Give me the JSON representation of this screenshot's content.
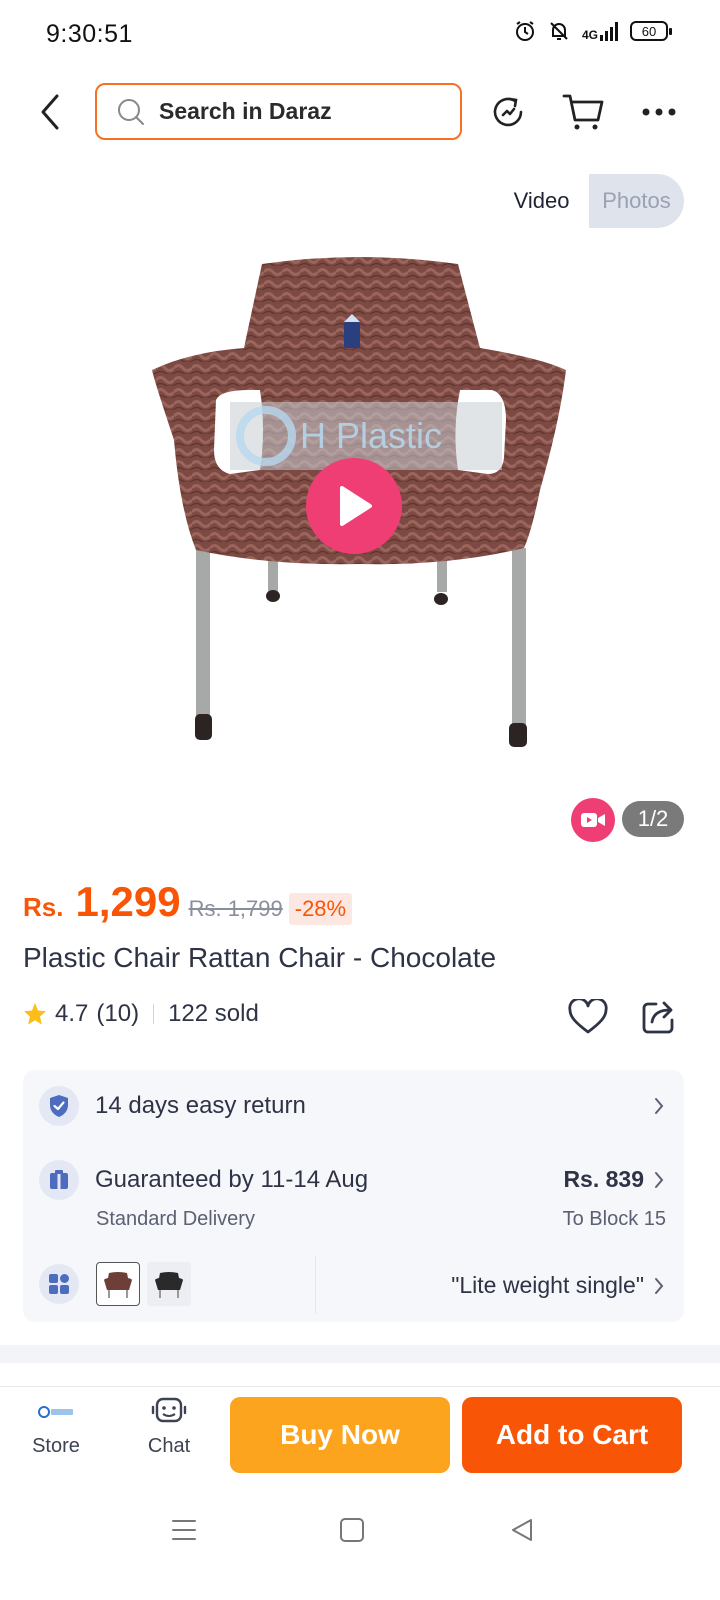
{
  "status_bar": {
    "time": "9:30:51",
    "network": "4G",
    "battery": "60",
    "icons": [
      "alarm-icon",
      "bell-off-icon",
      "signal-icon",
      "battery-icon"
    ]
  },
  "header": {
    "search_placeholder": "Search in Daraz",
    "icons": [
      "back-icon",
      "search-icon",
      "history-icon",
      "cart-icon",
      "more-icon"
    ]
  },
  "media": {
    "toggle": {
      "video_label": "Video",
      "photos_label": "Photos",
      "active": "Video"
    },
    "page_indicator": "1/2",
    "watermark_text": "H Plastic"
  },
  "product": {
    "currency": "Rs.",
    "price": "1,299",
    "original_price": "Rs. 1,799",
    "discount": "-28%",
    "title": "Plastic Chair Rattan Chair - Chocolate",
    "rating": "4.7",
    "rating_count": "(10)",
    "sold": "122 sold"
  },
  "info": {
    "returns": "14 days easy return",
    "delivery_title": "Guaranteed by 11-14 Aug",
    "delivery_type": "Standard Delivery",
    "delivery_price": "Rs. 839",
    "delivery_location": "To Block 15",
    "variant_label": "\"Lite weight single\""
  },
  "bottom_bar": {
    "store_label": "Store",
    "chat_label": "Chat",
    "buy_now": "Buy Now",
    "add_to_cart": "Add to Cart"
  },
  "colors": {
    "accent": "#f85606",
    "buy_now": "#fca41e",
    "play": "#ef3e73",
    "search_border": "#f57224"
  }
}
